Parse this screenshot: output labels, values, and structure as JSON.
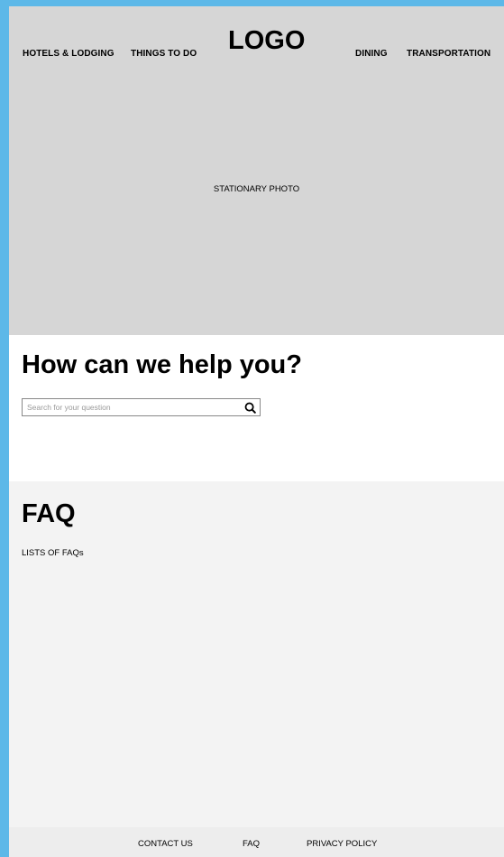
{
  "nav": {
    "left_items": [
      "HOTELS & LODGING",
      "THINGS TO DO"
    ],
    "logo": "LOGO",
    "right_items": [
      "DINING",
      "TRANSPORTATION"
    ]
  },
  "hero": {
    "caption": "STATIONARY PHOTO"
  },
  "help": {
    "title": "How can we help you?",
    "search_placeholder": "Search for your question",
    "search_value": ""
  },
  "faq": {
    "title": "FAQ",
    "list_text": "LISTS OF FAQs"
  },
  "footer": {
    "links": [
      "CONTACT US",
      "FAQ",
      "PRIVACY POLICY"
    ]
  },
  "colors": {
    "frame": "#5db8e8",
    "hero_bg": "#d6d6d6",
    "faq_bg": "#f3f3f3",
    "footer_bg": "#ededed"
  },
  "icons": {
    "search": "search-icon"
  }
}
